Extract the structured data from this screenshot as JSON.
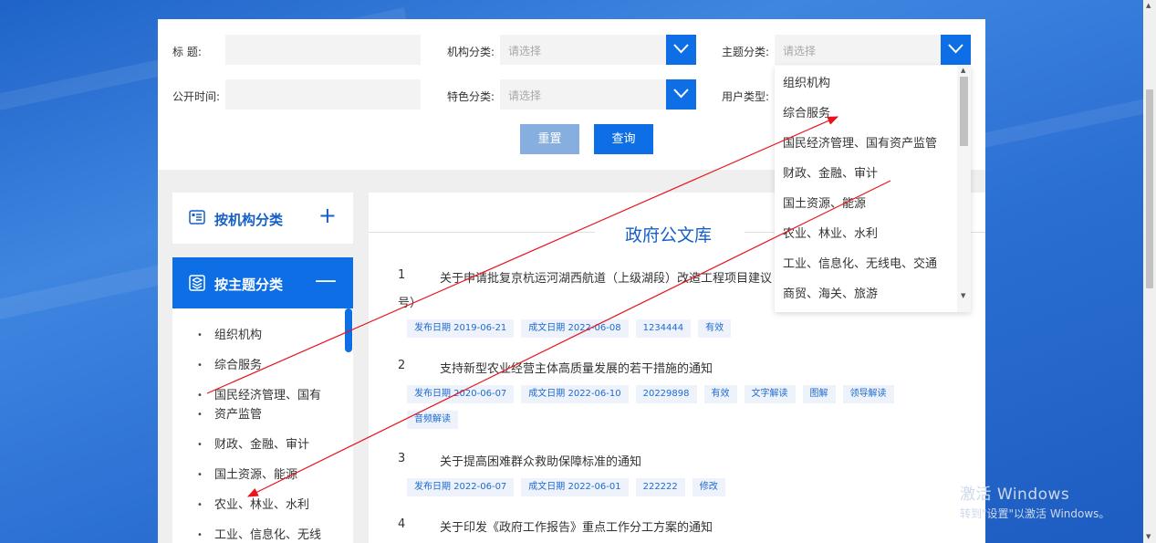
{
  "filters": {
    "title_label": "标    题:",
    "publish_time_label": "公开时间:",
    "org_label": "机构分类:",
    "org_placeholder": "请选择",
    "feature_label": "特色分类:",
    "feature_placeholder": "请选择",
    "topic_label": "主题分类:",
    "topic_placeholder": "请选择",
    "user_type_label": "用户类型:",
    "reset_label": "重置",
    "query_label": "查询"
  },
  "colors": {
    "primary": "#0d6ee6",
    "reset": "#86aede",
    "tag_bg": "#eef3fb",
    "tag_text": "#1d6ad1"
  },
  "sidebar": {
    "by_org": {
      "label": "按机构分类",
      "sign": "+",
      "icon": "doc-list-icon"
    },
    "by_topic": {
      "label": "按主题分类",
      "sign": "—",
      "icon": "layers-icon"
    },
    "items": [
      "组织机构",
      "综合服务",
      "国民经济管理、国有",
      "资产监管",
      "财政、金融、审计",
      "国土资源、能源",
      "农业、林业、水利",
      "工业、信息化、无线"
    ]
  },
  "main": {
    "title": "政府公文库",
    "docs": [
      {
        "num": "1",
        "title": "关于申请批复京杭运河湖西航道（上级湖段）改造工程项目建议",
        "title_cont": "号）",
        "tags": [
          "发布日期 2019-06-21",
          "成文日期 2022-06-08",
          "1234444",
          "有效"
        ]
      },
      {
        "num": "2",
        "title": "支持新型农业经营主体高质量发展的若干措施的通知",
        "tags": [
          "发布日期 2020-06-07",
          "成文日期 2022-06-10",
          "20229898",
          "有效",
          "文字解读",
          "图解",
          "领导解读",
          "音频解读"
        ]
      },
      {
        "num": "3",
        "title": "关于提高困难群众救助保障标准的通知",
        "tags": [
          "发布日期 2022-06-07",
          "成文日期 2022-06-01",
          "222222",
          "修改"
        ]
      },
      {
        "num": "4",
        "title": "关于印发《政府工作报告》重点工作分工方案的通知"
      }
    ]
  },
  "topic_dropdown": {
    "options": [
      "组织机构",
      "综合服务",
      "国民经济管理、国有资产监管",
      "财政、金融、审计",
      "国土资源、能源",
      "农业、林业、水利",
      "工业、信息化、无线电、交通",
      "商贸、海关、旅游"
    ]
  },
  "watermark": {
    "line1": "激活 Windows",
    "line2": "转到\"设置\"以激活 Windows。"
  }
}
